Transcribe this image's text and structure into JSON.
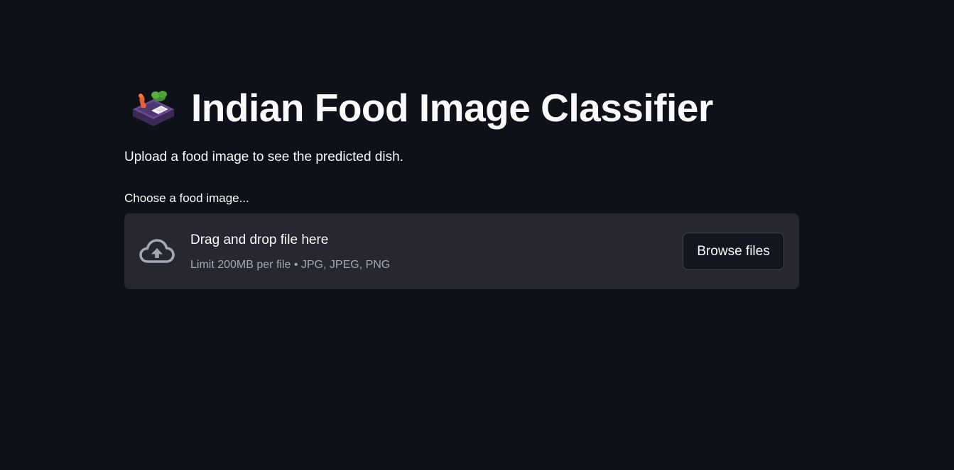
{
  "page": {
    "title": "Indian Food Image Classifier",
    "title_icon": "bento-box-emoji-icon",
    "subtitle": "Upload a food image to see the predicted dish."
  },
  "uploader": {
    "label": "Choose a food image...",
    "drop_text": "Drag and drop file here",
    "limits_text": "Limit 200MB per file • JPG, JPEG, PNG",
    "browse_label": "Browse files",
    "icon": "cloud-upload-icon"
  },
  "colors": {
    "background": "#0e1118",
    "dropzone": "#262730",
    "text": "#fafafa",
    "muted_text": "#a3a8b8"
  }
}
